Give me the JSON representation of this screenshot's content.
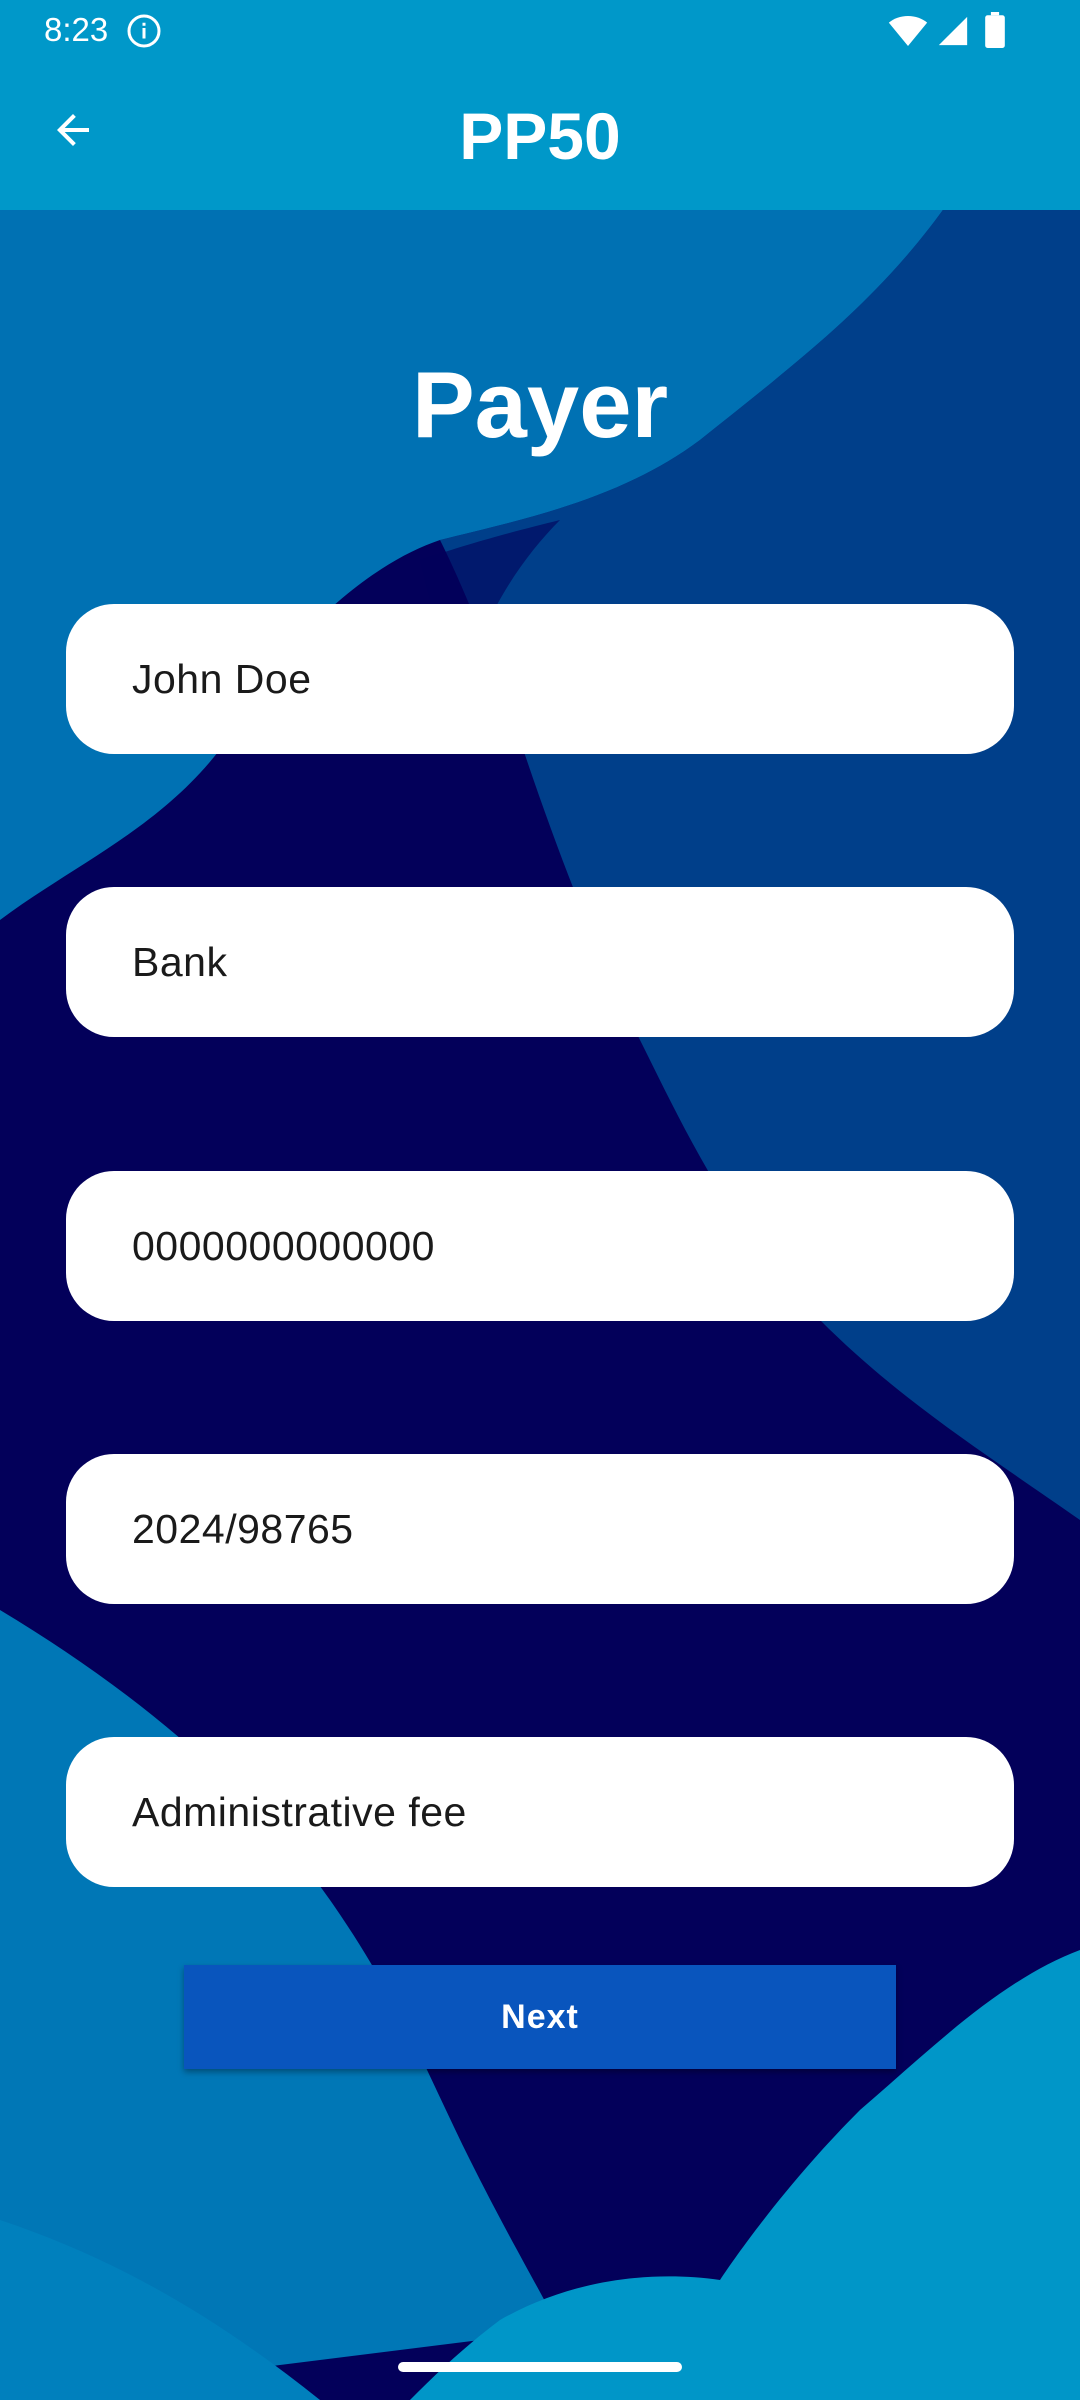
{
  "status_bar": {
    "time": "8:23",
    "icons": [
      "info-icon",
      "wifi-icon",
      "signal-icon",
      "battery-icon"
    ]
  },
  "app_bar": {
    "title": "PP50",
    "back_icon": "arrow-left-icon"
  },
  "page": {
    "title": "Payer"
  },
  "form": {
    "fields": [
      {
        "value": "John Doe"
      },
      {
        "value": "Bank"
      },
      {
        "value": "0000000000000"
      },
      {
        "value": "2024/98765"
      },
      {
        "value": "Administrative fee"
      }
    ],
    "next_label": "Next"
  },
  "colors": {
    "app_bar": "#0098c9",
    "background_dark": "#03005a",
    "background_mid": "#003f8a",
    "background_light": "#0077b6",
    "button": "#0955bd",
    "field": "#ffffff"
  }
}
